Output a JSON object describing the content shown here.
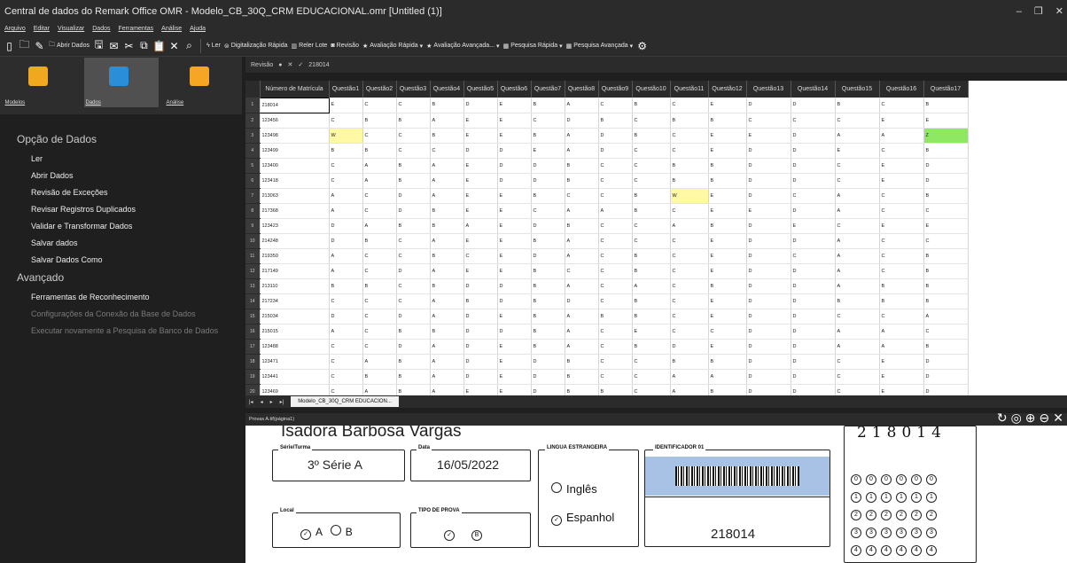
{
  "window": {
    "title": "Central de dados do Remark Office OMR - Modelo_CB_30Q_CRM EDUCACIONAL.omr [Untitled (1)]"
  },
  "menu": [
    "Arquivo",
    "Editar",
    "Visualizar",
    "Dados",
    "Ferramentas",
    "Análise",
    "Ajuda"
  ],
  "toolbar": {
    "open_data": "Abrir Dados",
    "read": "Ler",
    "quick_scan": "Digitalização Rápida",
    "reread_batch": "Reler Lote",
    "review": "Revisão",
    "quick_grade": "Avaliação Rápida",
    "advanced_grade": "Avaliação Avançada...",
    "quick_survey": "Pesquisa Rápida",
    "advanced_survey": "Pesquisa Avançada"
  },
  "left": {
    "tabs": [
      "Modelos",
      "Dados",
      "Análise"
    ],
    "section1": "Opção de Dados",
    "items1": [
      "Ler",
      "Abrir Dados",
      "Revisão de Exceções",
      "Revisar Registros Duplicados",
      "Validar e Transformar Dados",
      "Salvar dados",
      "Salvar Dados Como"
    ],
    "section2": "Avançado",
    "items2": [
      "Ferramentas de Reconhecimento"
    ],
    "items2_disabled": [
      "Configurações da Conexão da Base de Dados",
      "Executar novamente a Pesquisa de Banco de Dados"
    ]
  },
  "review_bar": {
    "label": "Revisão",
    "value": "218014"
  },
  "grid": {
    "headers": [
      "Número de Matrícula",
      "Questão1",
      "Questão2",
      "Questão3",
      "Questão4",
      "Questão5",
      "Questão6",
      "Questão7",
      "Questão8",
      "Questão9",
      "Questão10",
      "Questão11",
      "Questão12",
      "Questão13",
      "Questão14",
      "Questão15",
      "Questão16",
      "Questão17"
    ],
    "rows": [
      [
        "218014",
        "E",
        "C",
        "C",
        "B",
        "D",
        "E",
        "B",
        "A",
        "C",
        "B",
        "C",
        "E",
        "D",
        "D",
        "B",
        "C",
        "B"
      ],
      [
        "123456",
        "C",
        "B",
        "B",
        "A",
        "E",
        "E",
        "C",
        "D",
        "B",
        "C",
        "B",
        "B",
        "C",
        "C",
        "C",
        "E",
        "E"
      ],
      [
        "123498",
        "W",
        "C",
        "C",
        "B",
        "E",
        "E",
        "B",
        "A",
        "D",
        "B",
        "C",
        "E",
        "E",
        "D",
        "A",
        "A",
        "Z"
      ],
      [
        "123499",
        "B",
        "B",
        "C",
        "C",
        "D",
        "D",
        "E",
        "A",
        "D",
        "C",
        "C",
        "E",
        "D",
        "D",
        "E",
        "C",
        "B"
      ],
      [
        "123400",
        "C",
        "A",
        "B",
        "A",
        "E",
        "D",
        "D",
        "B",
        "C",
        "C",
        "B",
        "B",
        "D",
        "D",
        "C",
        "E",
        "D"
      ],
      [
        "123418",
        "C",
        "A",
        "B",
        "A",
        "E",
        "D",
        "D",
        "B",
        "C",
        "C",
        "B",
        "B",
        "D",
        "D",
        "C",
        "E",
        "D"
      ],
      [
        "213063",
        "A",
        "C",
        "D",
        "A",
        "E",
        "E",
        "B",
        "C",
        "C",
        "B",
        "W",
        "E",
        "D",
        "C",
        "A",
        "C",
        "B"
      ],
      [
        "217368",
        "A",
        "C",
        "D",
        "B",
        "E",
        "E",
        "C",
        "A",
        "A",
        "B",
        "C",
        "E",
        "E",
        "D",
        "A",
        "C",
        "C"
      ],
      [
        "123423",
        "D",
        "A",
        "B",
        "B",
        "A",
        "E",
        "D",
        "B",
        "C",
        "C",
        "A",
        "B",
        "D",
        "E",
        "C",
        "E",
        "E"
      ],
      [
        "214248",
        "D",
        "B",
        "C",
        "A",
        "E",
        "E",
        "B",
        "A",
        "C",
        "C",
        "C",
        "E",
        "D",
        "D",
        "A",
        "C",
        "C"
      ],
      [
        "219350",
        "A",
        "C",
        "C",
        "B",
        "C",
        "E",
        "D",
        "A",
        "C",
        "B",
        "C",
        "E",
        "D",
        "C",
        "A",
        "C",
        "B"
      ],
      [
        "217149",
        "A",
        "C",
        "D",
        "A",
        "E",
        "E",
        "B",
        "C",
        "C",
        "B",
        "C",
        "E",
        "D",
        "D",
        "A",
        "C",
        "B"
      ],
      [
        "213110",
        "B",
        "B",
        "C",
        "B",
        "D",
        "D",
        "B",
        "A",
        "C",
        "A",
        "C",
        "B",
        "D",
        "D",
        "A",
        "B",
        "B"
      ],
      [
        "217234",
        "C",
        "C",
        "C",
        "A",
        "B",
        "D",
        "B",
        "D",
        "C",
        "B",
        "C",
        "E",
        "D",
        "D",
        "B",
        "B",
        "B"
      ],
      [
        "215034",
        "D",
        "C",
        "D",
        "A",
        "D",
        "E",
        "B",
        "A",
        "B",
        "B",
        "C",
        "E",
        "D",
        "D",
        "C",
        "C",
        "A"
      ],
      [
        "215015",
        "A",
        "C",
        "B",
        "B",
        "D",
        "D",
        "B",
        "A",
        "C",
        "E",
        "C",
        "C",
        "D",
        "D",
        "A",
        "A",
        "C"
      ],
      [
        "123488",
        "C",
        "C",
        "D",
        "A",
        "D",
        "E",
        "B",
        "A",
        "C",
        "B",
        "D",
        "E",
        "D",
        "D",
        "A",
        "A",
        "B"
      ],
      [
        "123471",
        "C",
        "A",
        "B",
        "A",
        "D",
        "E",
        "D",
        "B",
        "C",
        "C",
        "B",
        "B",
        "D",
        "D",
        "C",
        "E",
        "D"
      ],
      [
        "123441",
        "C",
        "B",
        "B",
        "A",
        "D",
        "E",
        "D",
        "B",
        "C",
        "C",
        "A",
        "A",
        "D",
        "D",
        "C",
        "E",
        "D"
      ],
      [
        "123469",
        "C",
        "A",
        "B",
        "A",
        "E",
        "E",
        "D",
        "B",
        "B",
        "C",
        "A",
        "B",
        "D",
        "D",
        "C",
        "E",
        "D"
      ]
    ]
  },
  "sheet_tab": "Modelo_CB_30Q_CRM EDUCACION...",
  "image_view": {
    "file": "Provas A.tif(página1)",
    "name": "Isadora Barbosa Vargas",
    "serie_label": "Série/Turma",
    "serie_value": "3º Série A",
    "data_label": "Data",
    "data_value": "16/05/2022",
    "lingua_label": "LINGUA ESTRANGEIRA",
    "ingles": "Inglês",
    "espanhol": "Espanhol",
    "ident_label": "IDENTIFICADOR 01",
    "ident_value": "218014",
    "local_label": "Local",
    "tipo_label": "TIPO DE PROVA",
    "option_a": "A",
    "option_b": "B",
    "handwritten_id": "218014"
  }
}
